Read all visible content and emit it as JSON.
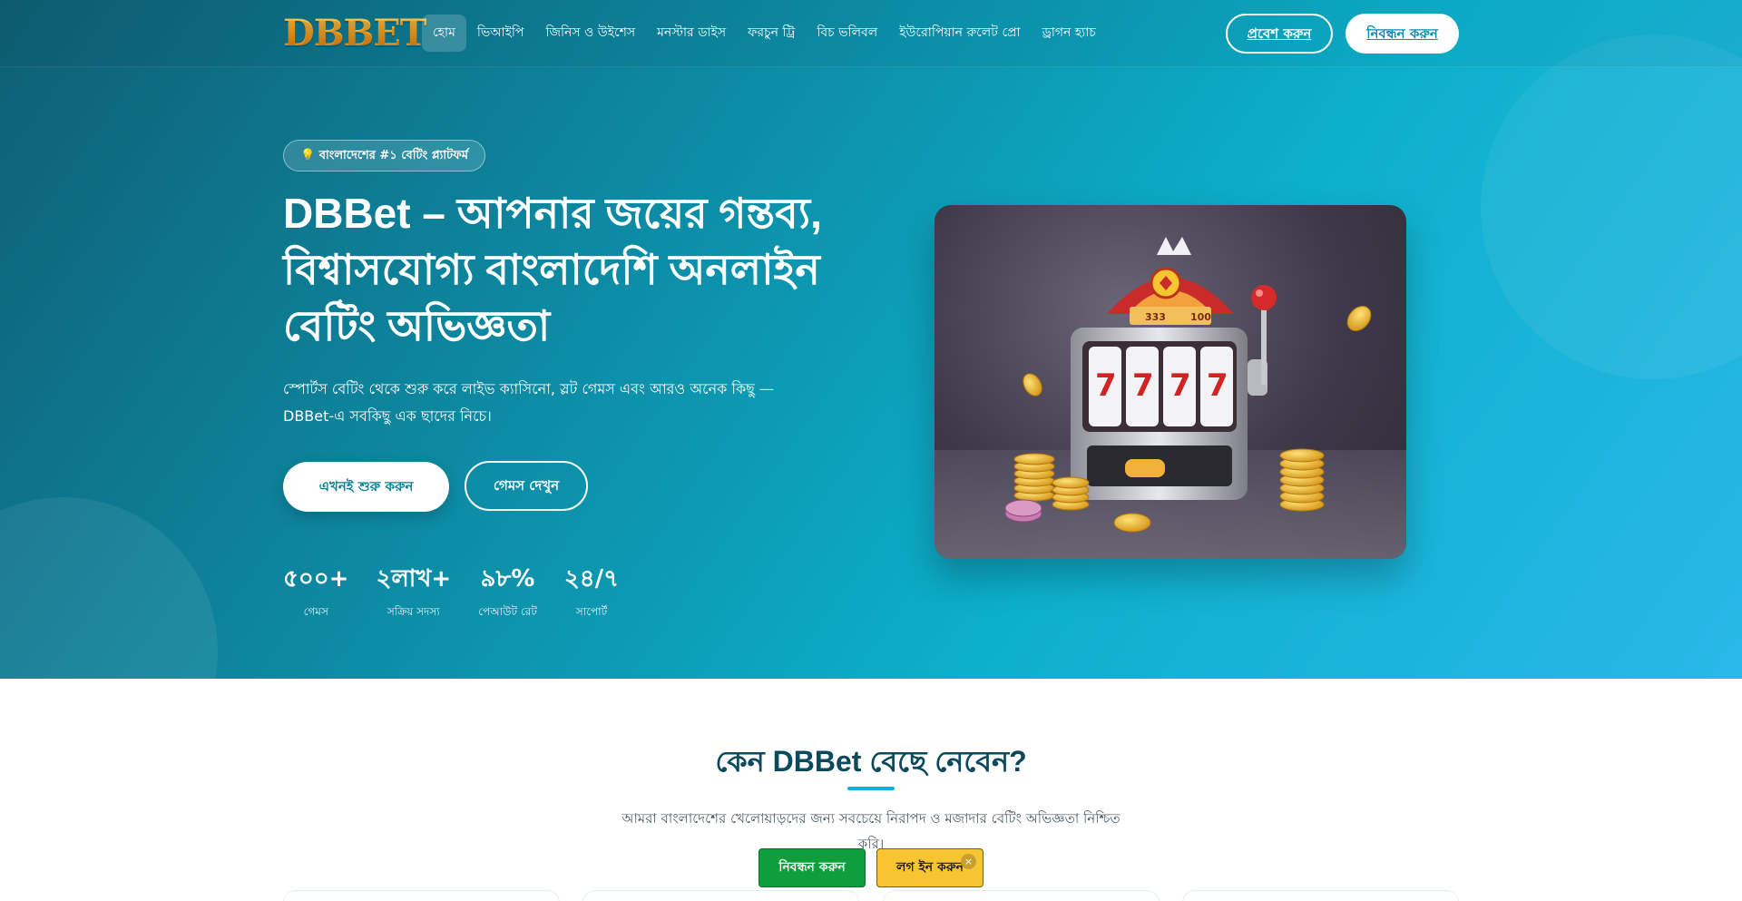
{
  "brand": {
    "logo_text": "DBBET",
    "logo_color": "#f5a623"
  },
  "nav": {
    "items": [
      {
        "label": "হোম",
        "active": true
      },
      {
        "label": "ভিআইপি"
      },
      {
        "label": "জিনিস ও উইশেস"
      },
      {
        "label": "মনস্টার ডাইস"
      },
      {
        "label": "ফরচুন ট্রি"
      },
      {
        "label": "বিচ ভলিবল"
      },
      {
        "label": "ইউরোপিয়ান রুলেট প্রো"
      },
      {
        "label": "ড্রাগন হ্যাচ"
      }
    ],
    "login_label": "প্রবেশ করুন",
    "register_label": "নিবন্ধন করুন"
  },
  "hero": {
    "badge_icon": "lightbulb-icon",
    "badge_text": "💡 বাংলাদেশের #১ বেটিং প্ল্যাটফর্ম",
    "title": "DBBet – আপনার জয়ের গন্তব্য, বিশ্বাসযোগ্য বাংলাদেশি অনলাইন বেটিং অভিজ্ঞতা",
    "subtitle": "স্পোর্টস বেটিং থেকে শুরু করে লাইভ ক্যাসিনো, স্লট গেমস এবং আরও অনেক কিছু — DBBet-এ সবকিছু এক ছাদের নিচে।",
    "start_button": "এখনই শুরু করুন",
    "games_button": "গেমস দেখুন",
    "stats": [
      {
        "value": "৫০০+",
        "label": "গেমস"
      },
      {
        "value": "২লাখ+",
        "label": "সক্রিয় সদস্য"
      },
      {
        "value": "৯৮%",
        "label": "পেআউট রেট"
      },
      {
        "value": "২৪/৭",
        "label": "সাপোর্ট"
      }
    ],
    "slot_reel_symbol": "7",
    "slot_top_numbers": [
      "333",
      "100"
    ]
  },
  "why_section": {
    "title": "কেন DBBet বেছে নেবেন?",
    "description": "আমরা বাংলাদেশের খেলোয়াড়দের জন্য সবচেয়ে নিরাপদ ও মজাদার বেটিং অভিজ্ঞতা নিশ্চিত করি।"
  },
  "floating_bar": {
    "register_label": "নিবন্ধন করুন",
    "login_label": "লগ ইন করুন",
    "close_symbol": "×"
  },
  "colors": {
    "hero_gradient_start": "#0e5f73",
    "hero_gradient_end": "#2ab8e8",
    "section_title": "#0b4a5c",
    "accent": "#12b0d8",
    "float_register": "#0f9e3e",
    "float_login": "#f7c531"
  }
}
